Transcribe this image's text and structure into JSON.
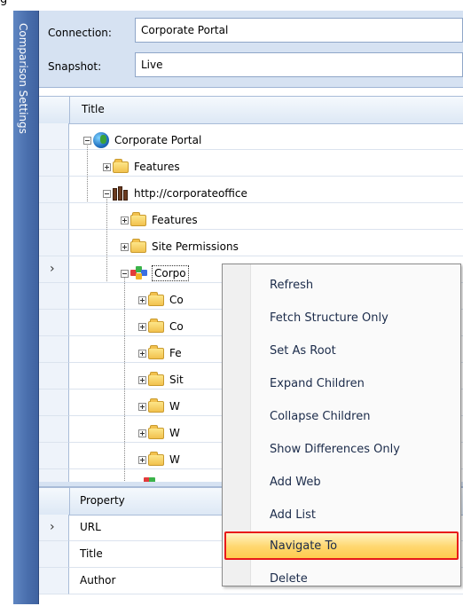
{
  "sidebar": {
    "tab_label": "Comparison Settings"
  },
  "settings": {
    "connection_label": "Connection:",
    "connection_value": "Corporate Portal",
    "snapshot_label": "Snapshot:",
    "snapshot_value": "Live"
  },
  "tree": {
    "column_title": "Title",
    "nodes": [
      "Corporate Portal",
      "Features",
      "http://corporateoffice",
      "Features",
      "Site Permissions",
      "Corpo",
      "Co",
      "Co",
      "Fe",
      "Sit",
      "W",
      "W",
      "W"
    ]
  },
  "properties": {
    "column_title": "Property",
    "rows": [
      "URL",
      "Title",
      "Author"
    ]
  },
  "context_menu": {
    "items": [
      "Refresh",
      "Fetch Structure Only",
      "Set As Root",
      "Expand Children",
      "Collapse Children",
      "Show Differences Only",
      "Add Web",
      "Add List",
      "Navigate To",
      "Delete"
    ],
    "highlighted_index": 8
  },
  "colors": {
    "tab_blue": "#4a6fad",
    "panel_blue": "#d6e2f2",
    "highlight_yellow": "#ffd76e",
    "highlight_border": "#e81a1a"
  }
}
